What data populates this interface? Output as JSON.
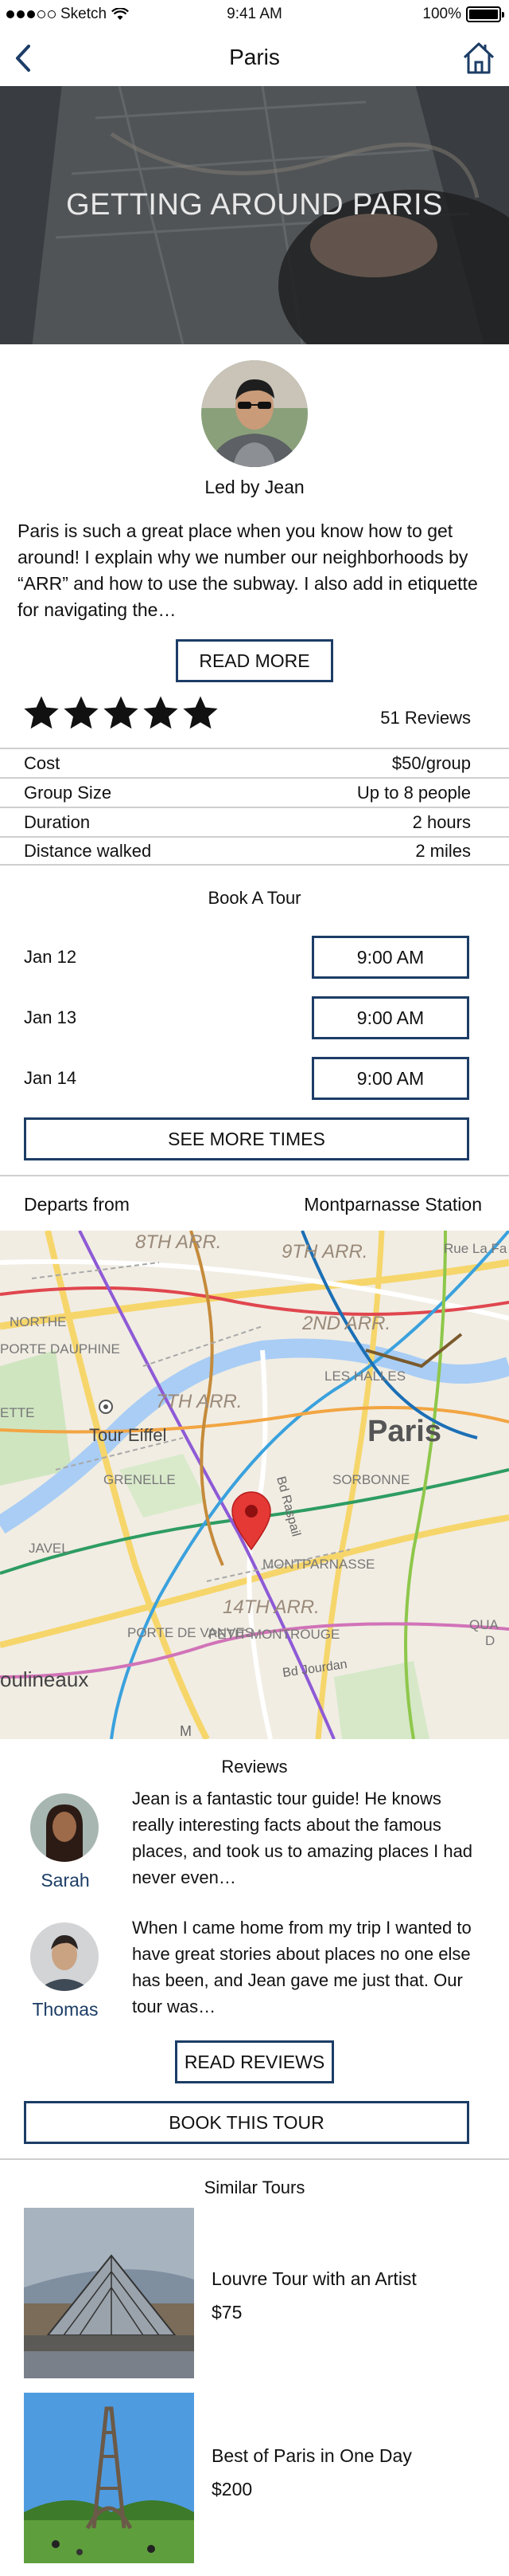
{
  "status_bar": {
    "carrier": "Sketch",
    "time": "9:41 AM",
    "battery": "100%"
  },
  "nav": {
    "title": "Paris"
  },
  "hero": {
    "title": "GETTING AROUND PARIS"
  },
  "guide": {
    "led_by": "Led by Jean",
    "description": "Paris is such a great place when you know how to get around! I explain why we number our neighborhoods by “ARR” and how to use the subway. I also add in etiquette for navigating the…",
    "read_more": "READ MORE"
  },
  "rating": {
    "stars": 5,
    "max_stars": 5,
    "reviews": "51 Reviews"
  },
  "details": [
    {
      "label": "Cost",
      "value": "$50/group"
    },
    {
      "label": "Group Size",
      "value": "Up to 8 people"
    },
    {
      "label": "Duration",
      "value": "2 hours"
    },
    {
      "label": "Distance walked",
      "value": "2 miles"
    }
  ],
  "booking": {
    "title": "Book A Tour",
    "dates": [
      {
        "date": "Jan 12",
        "time": "9:00 AM"
      },
      {
        "date": "Jan 13",
        "time": "9:00 AM"
      },
      {
        "date": "Jan 14",
        "time": "9:00 AM"
      }
    ],
    "see_more": "SEE MORE TIMES"
  },
  "departs": {
    "label": "Departs from",
    "value": "Montparnasse Station"
  },
  "map": {
    "labels": {
      "arr9": "9TH ARR.",
      "arr8": "8TH ARR.",
      "arr2": "2ND ARR.",
      "arr7": "7TH ARR.",
      "arr14": "14TH ARR.",
      "paris": "Paris",
      "tour_eiffel": "Tour Eiffel",
      "porte_dauphine": "PORTE DAUPHINE",
      "neighborhood_ette": "ETTE",
      "grenelle": "GRENELLE",
      "sorbonne": "SORBONNE",
      "les_halles": "LES HALLES",
      "javel": "JAVEL",
      "montparnasse": "MONTPARNASSE",
      "petit_montrouge": "PETIT-MONTROUGE",
      "porte_de_vanves": "PORTE DE VANVES",
      "moulineaux": "oulineaux",
      "bd_jourdan": "Bd Jourdan",
      "bd_raspail": "Bd Raspail",
      "rue_la_fayette": "Rue La Fa",
      "quai": "QUA",
      "quai2": "D",
      "bottom_cut": "M",
      "north_cut": "NORTHE"
    }
  },
  "reviews": {
    "title": "Reviews",
    "items": [
      {
        "name": "Sarah",
        "text": "Jean is a fantastic tour guide! He knows really interesting facts about the famous places, and took us to amazing places I had never even…"
      },
      {
        "name": "Thomas",
        "text": "When I came home from my trip I wanted to have great stories about places no one else has been, and Jean gave me just that. Our tour was…"
      }
    ],
    "read_reviews": "READ REVIEWS"
  },
  "book_tour": "BOOK THIS TOUR",
  "similar": {
    "title": "Similar Tours",
    "items": [
      {
        "name": "Louvre Tour with an Artist",
        "price": "$75"
      },
      {
        "name": "Best of Paris in One Day",
        "price": "$200"
      }
    ]
  },
  "colors": {
    "accent": "#1c3d66",
    "divider": "#cfcfcf",
    "map_pin": "#e53935"
  }
}
